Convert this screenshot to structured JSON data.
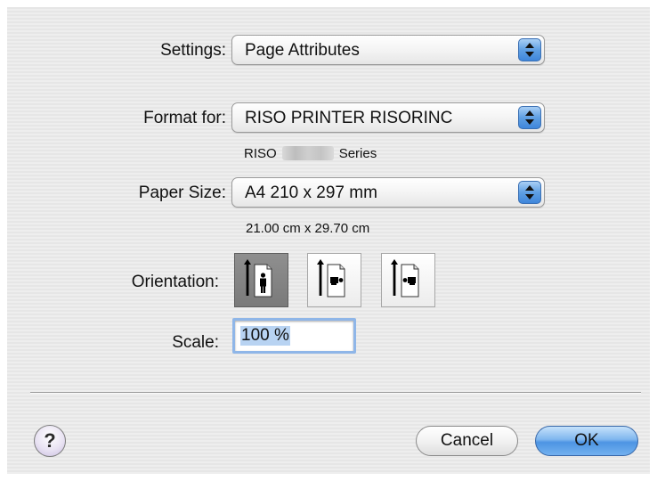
{
  "settings": {
    "label": "Settings:",
    "value": "Page Attributes"
  },
  "format_for": {
    "label": "Format for:",
    "value": "RISO PRINTER RISORINC",
    "model_prefix": "RISO",
    "model_suffix": "Series"
  },
  "paper_size": {
    "label": "Paper Size:",
    "value": "A4 210 x 297 mm",
    "dimensions": "21.00 cm x 29.70 cm"
  },
  "orientation": {
    "label": "Orientation:",
    "options": [
      {
        "name": "portrait",
        "selected": true
      },
      {
        "name": "landscape-left",
        "selected": false
      },
      {
        "name": "landscape-right",
        "selected": false
      }
    ]
  },
  "scale": {
    "label": "Scale:",
    "value": "100 %"
  },
  "buttons": {
    "help": "?",
    "cancel": "Cancel",
    "ok": "OK"
  },
  "colors": {
    "accent": "#4d94e3",
    "popup_arrow": "#3f86db"
  }
}
